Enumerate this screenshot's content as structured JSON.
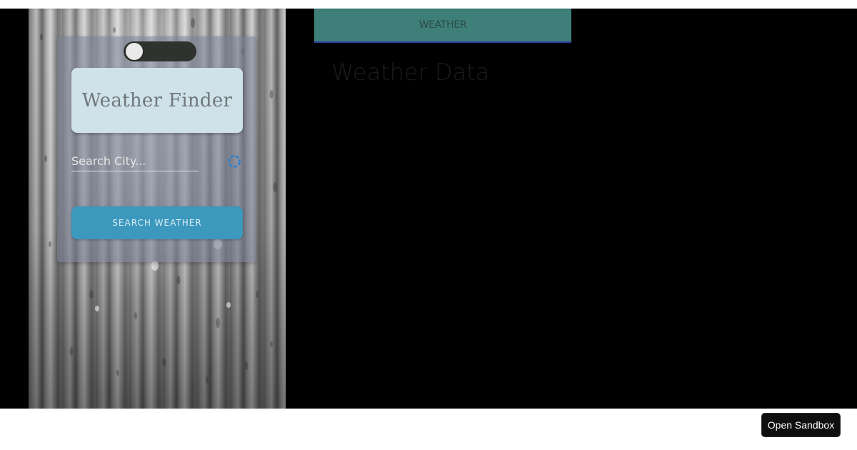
{
  "toggle": {
    "state": "off"
  },
  "card": {
    "title": "Weather Finder",
    "search_placeholder": "Search City...",
    "search_button_label": "SEARCH WEATHER",
    "spinner_icon": "loading-spinner-icon"
  },
  "results": {
    "tab_label": "WEATHER",
    "heading": "Weather Data"
  },
  "footer": {
    "open_sandbox_label": "Open Sandbox"
  },
  "colors": {
    "tab_background": "#3f7f79",
    "tab_underline": "#2f3fa0",
    "search_button": "#3d98be",
    "title_box": "#cfe2e9",
    "spinner": "#2d7fd1"
  }
}
